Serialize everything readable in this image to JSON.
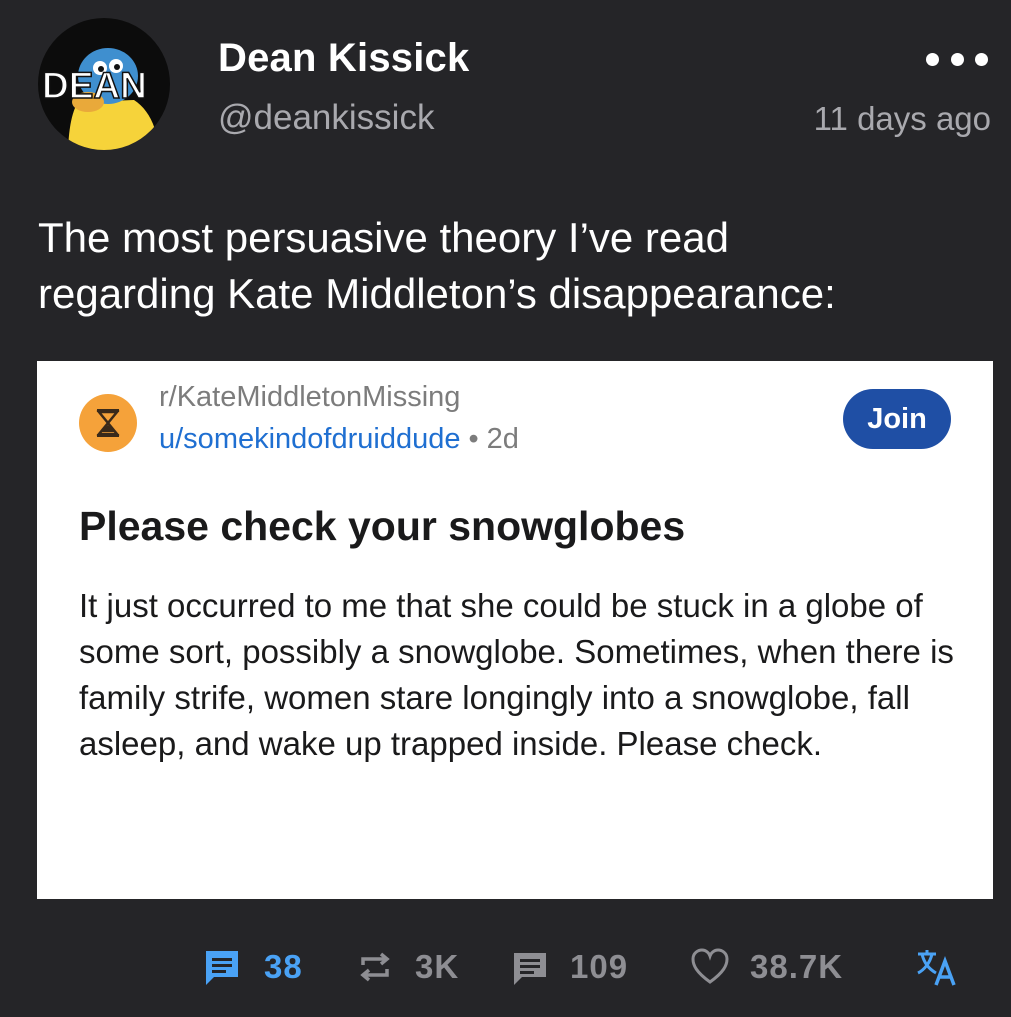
{
  "author": {
    "avatar_text": "DEAN",
    "display_name": "Dean Kissick",
    "handle": "@deankissick",
    "timestamp": "11 days ago"
  },
  "post": {
    "text": "The most persuasive theory I’ve read\nregarding Kate Middleton’s disappearance:"
  },
  "embed": {
    "subreddit": "r/KateMiddletonMissing",
    "username": "u/somekindofdruiddude",
    "separator": "•",
    "age": "2d",
    "join_label": "Join",
    "title": "Please check your snowglobes",
    "body": "It just occurred to me that she could be stuck in a globe of some sort, possibly a snowglobe. Sometimes, when there is family strife, women stare longingly into a snowglobe, fall asleep, and wake up trapped inside. Please check."
  },
  "actions": {
    "quotes": {
      "icon": "quote-icon",
      "count": "38",
      "color": "#4aa2f5"
    },
    "reposts": {
      "icon": "repost-icon",
      "count": "3K",
      "color": "#8e8e93"
    },
    "replies": {
      "icon": "reply-icon",
      "count": "109",
      "color": "#8e8e93"
    },
    "likes": {
      "icon": "heart-icon",
      "count": "38.7K",
      "color": "#8e8e93"
    },
    "translate": {
      "icon": "translate-icon",
      "color": "#4aa2f5"
    }
  },
  "colors": {
    "background": "#252528",
    "embed_background": "#ffffff",
    "link": "#1f6fd1",
    "join_button": "#1f4fa5",
    "subreddit_icon": "#f5a23a"
  }
}
